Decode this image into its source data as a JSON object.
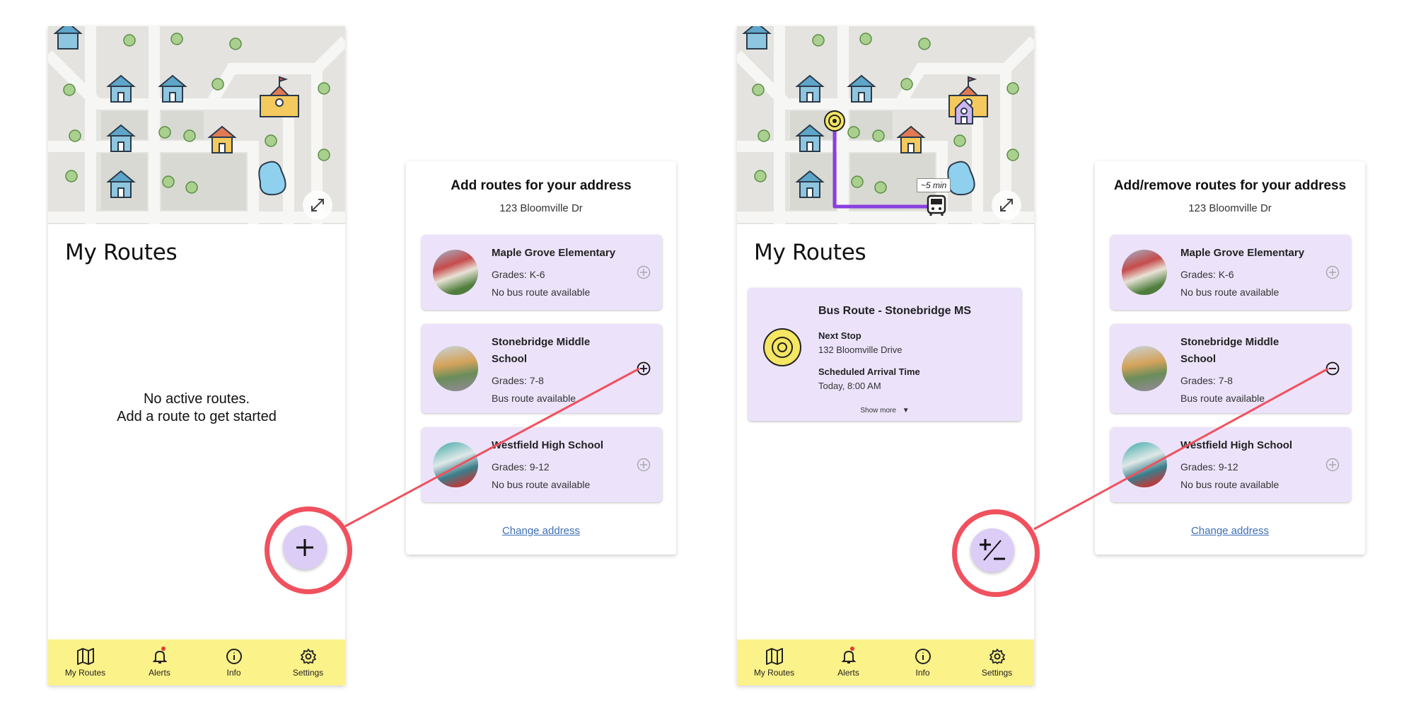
{
  "screens": [
    {
      "title": "My Routes",
      "empty_line1": "No active routes.",
      "empty_line2": "Add a route to get started",
      "fab_icon": "plus-icon"
    },
    {
      "title": "My Routes",
      "fab_icon": "plus-minus-icon",
      "eta": "~5 min",
      "route": {
        "title": "Bus Route - Stonebridge MS",
        "next_stop_label": "Next Stop",
        "next_stop_value": "132 Bloomville Drive",
        "arrival_label": "Scheduled Arrival Time",
        "arrival_value": "Today, 8:00 AM",
        "show_more": "Show more"
      }
    }
  ],
  "nav": [
    {
      "label": "My Routes",
      "icon": "map-icon"
    },
    {
      "label": "Alerts",
      "icon": "bell-icon"
    },
    {
      "label": "Info",
      "icon": "info-icon"
    },
    {
      "label": "Settings",
      "icon": "gear-icon"
    }
  ],
  "panels": [
    {
      "title": "Add routes for your address",
      "address": "123 Bloomville Dr",
      "change": "Change address",
      "schools": [
        {
          "name": "Maple Grove Elementary",
          "grades": "Grades: K-6",
          "status": "No bus route available",
          "action": "add-disabled"
        },
        {
          "name": "Stonebridge Middle School",
          "grades": "Grades: 7-8",
          "status": "Bus route available",
          "action": "add"
        },
        {
          "name": "Westfield High School",
          "grades": "Grades: 9-12",
          "status": "No bus route available",
          "action": "add-disabled"
        }
      ]
    },
    {
      "title": "Add/remove routes for your address",
      "address": "123 Bloomville Dr",
      "change": "Change address",
      "schools": [
        {
          "name": "Maple Grove Elementary",
          "grades": "Grades: K-6",
          "status": "No bus route available",
          "action": "add-disabled"
        },
        {
          "name": "Stonebridge Middle School",
          "grades": "Grades: 7-8",
          "status": "Bus route available",
          "action": "remove"
        },
        {
          "name": "Westfield High School",
          "grades": "Grades: 9-12",
          "status": "No bus route available",
          "action": "add-disabled"
        }
      ]
    }
  ],
  "colors": {
    "nav_bg": "#fcf28a",
    "card_bg": "#ece3fb",
    "fab_bg": "#dccdf7",
    "highlight": "#f0515e",
    "route_line": "#8a3fe0",
    "link": "#3d6fb5"
  }
}
